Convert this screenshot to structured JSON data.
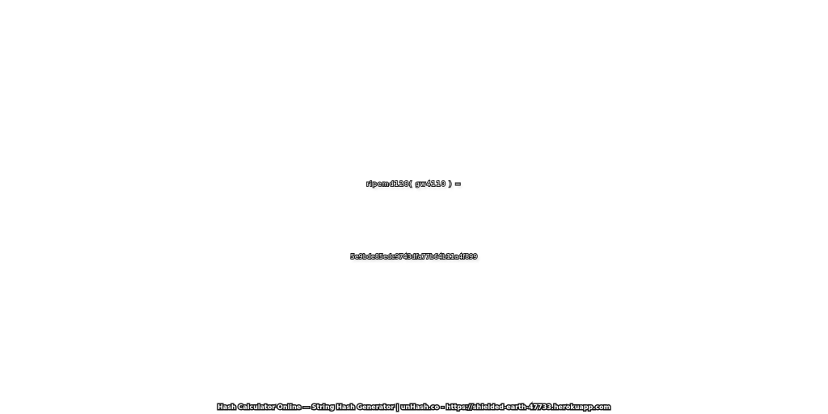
{
  "expression": "ripemd128( gw4110 ) =",
  "hash_result": "5e9bde85edc9743dfa77b64b11a4f899",
  "footer": "Hash Calculator Online — String Hash Generator | unHash.co - https://shielded-earth-47733.herokuapp.com",
  "colors": {
    "background": "#ffffff",
    "text_fill": "#ffffff",
    "text_outline": "#1a1a1a"
  }
}
